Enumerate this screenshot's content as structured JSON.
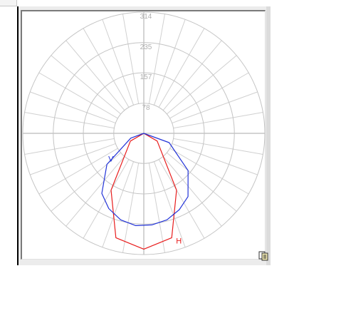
{
  "chart_data": {
    "type": "polar",
    "grid": true,
    "radial_ticks": [
      "78",
      "157",
      "235",
      "314"
    ],
    "series": [
      {
        "name": "H",
        "color": "#e81c1c",
        "points": [
          [
            0,
            0
          ],
          [
            30,
            40
          ],
          [
            60,
            170
          ],
          [
            75,
            280
          ],
          [
            90,
            300
          ],
          [
            105,
            280
          ],
          [
            120,
            170
          ],
          [
            150,
            40
          ],
          [
            180,
            0
          ]
        ]
      },
      {
        "name": "V",
        "color": "#2233d8",
        "points": [
          [
            0,
            0
          ],
          [
            20,
            36
          ],
          [
            40,
            125
          ],
          [
            55,
            190
          ],
          [
            65,
            215
          ],
          [
            75,
            232
          ],
          [
            85,
            240
          ],
          [
            95,
            238
          ],
          [
            105,
            232
          ],
          [
            115,
            218
          ],
          [
            125,
            200
          ],
          [
            140,
            150
          ],
          [
            160,
            70
          ],
          [
            180,
            0
          ]
        ]
      }
    ]
  },
  "icons": {
    "copy": "copy-clipboard-icon"
  }
}
